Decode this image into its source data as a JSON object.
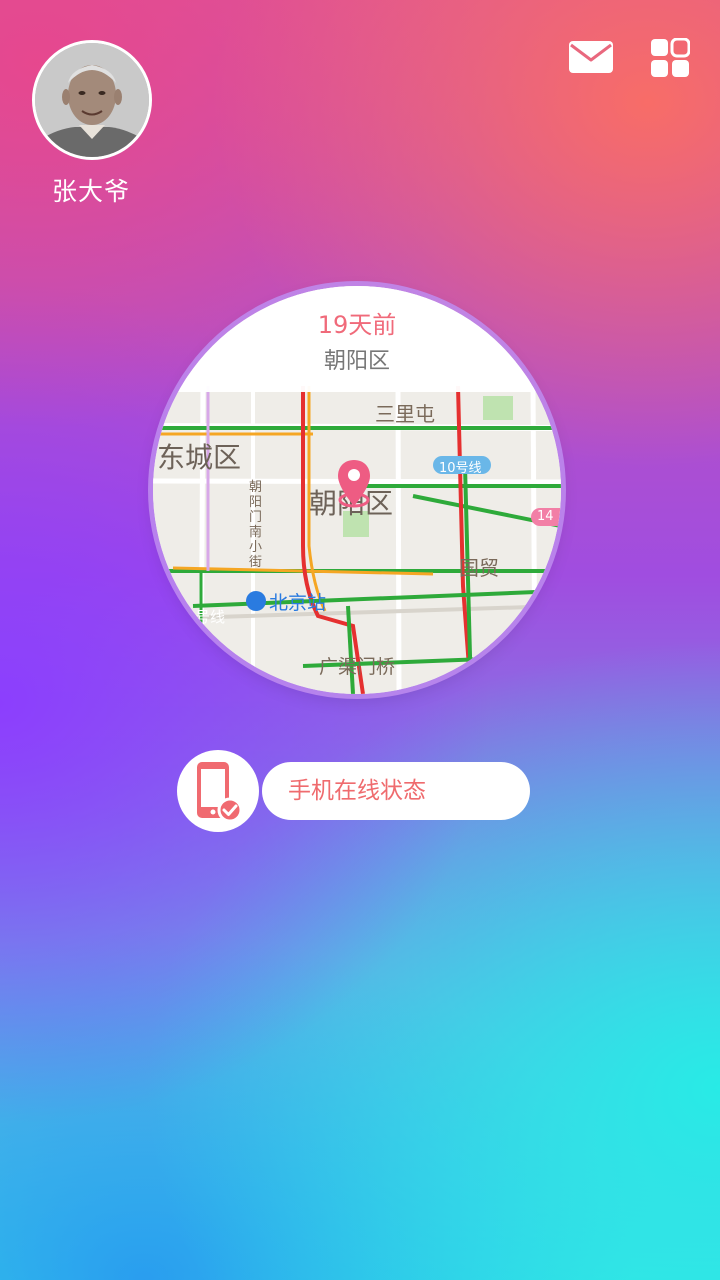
{
  "user": {
    "name": "张大爷"
  },
  "header": {
    "mail_icon": "envelope-icon",
    "menu_icon": "grid-icon"
  },
  "location_card": {
    "time": "19天前",
    "area": "朝阳区",
    "map_labels": {
      "sanlitun": "三里屯",
      "dongcheng": "东城区",
      "chaoyang": "朝阳区",
      "line10": "10号线",
      "line14": "14",
      "street": "朝阳门南小街",
      "guomao": "国贸",
      "beijing_station": "北京站",
      "line_fragment": "号线",
      "guangqumen": "广渠门桥"
    }
  },
  "phone_status": {
    "label": "手机在线状态",
    "icon": "phone-check-icon"
  },
  "colors": {
    "accent": "#f06a7a",
    "white": "#ffffff"
  }
}
